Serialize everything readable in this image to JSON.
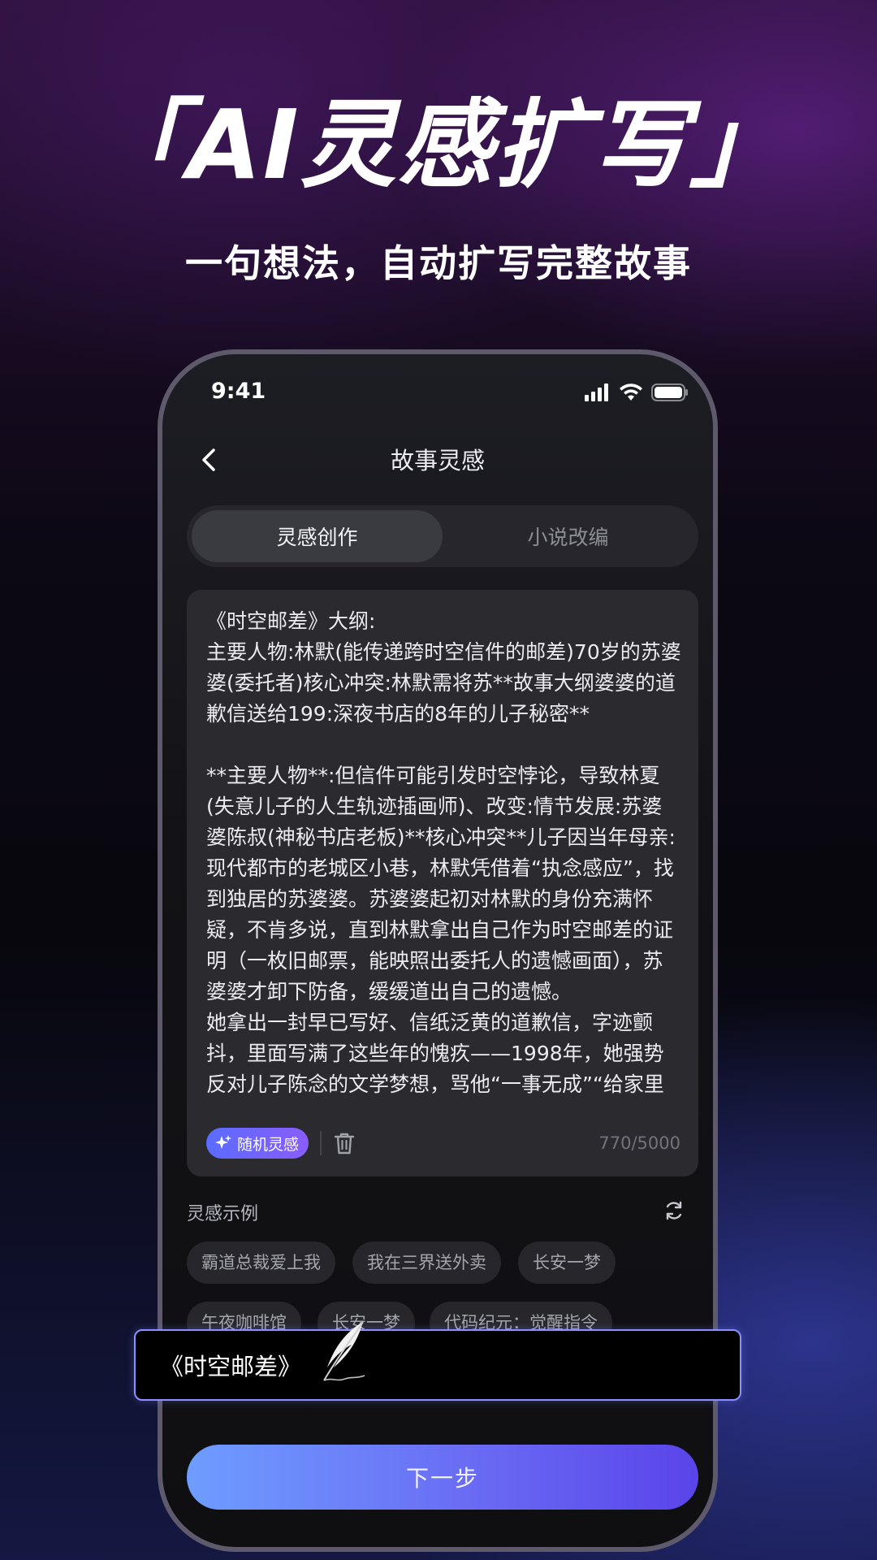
{
  "promo": {
    "headline": "「AI灵感扩写」",
    "subline": "一句想法，自动扩写完整故事"
  },
  "status_bar": {
    "time": "9:41"
  },
  "nav": {
    "title": "故事灵感"
  },
  "tabs": [
    {
      "label": "灵感创作",
      "active": true
    },
    {
      "label": "小说改编",
      "active": false
    }
  ],
  "editor": {
    "text": "《时空邮差》大纲:\n主要人物:林默(能传递跨时空信件的邮差)70岁的苏婆婆(委托者)核心冲突:林默需将苏**故事大纲婆婆的道歉信送给199:深夜书店的8年的儿子秘密**\n\n**主要人物**:但信件可能引发时空悖论，导致林夏(失意儿子的人生轨迹插画师)、改变:情节发展:苏婆婆陈叔(神秘书店老板)**核心冲突**儿子因当年母亲:现代都市的老城区小巷，林默凭借着“执念感应”，找到独居的苏婆婆。苏婆婆起初对林默的身份充满怀疑，不肯多说，直到林默拿出自己作为时空邮差的证明（一枚旧邮票，能映照出委托人的遗憾画面），苏婆婆才卸下防备，缓缓道出自己的遗憾。\n她拿出一封早已写好、信纸泛黄的道歉信，字迹颤抖，里面写满了这些年的愧疚——1998年，她强势反对儿子陈念的文学梦想，骂他“一事无成”“给家里",
    "random_label": "随机灵感",
    "counter": "770/5000"
  },
  "examples": {
    "title": "灵感示例",
    "chips": [
      "霸道总裁爱上我",
      "我在三界送外卖",
      "长安一梦",
      "午夜咖啡馆",
      "长安一梦",
      "代码纪元：觉醒指令"
    ]
  },
  "next_label": "下一步",
  "overlay": {
    "text": "《时空邮差》"
  },
  "icons": {
    "back": "chevron-left-icon",
    "signal": "signal-icon",
    "wifi": "wifi-icon",
    "battery": "battery-icon",
    "sparkle": "sparkle-icon",
    "trash": "trash-icon",
    "refresh": "refresh-icon",
    "quill": "quill-icon"
  },
  "colors": {
    "accent_start": "#6e9dff",
    "accent_end": "#5a44ea",
    "phone_bg": "#131317",
    "card_bg": "#2a2a2f"
  }
}
